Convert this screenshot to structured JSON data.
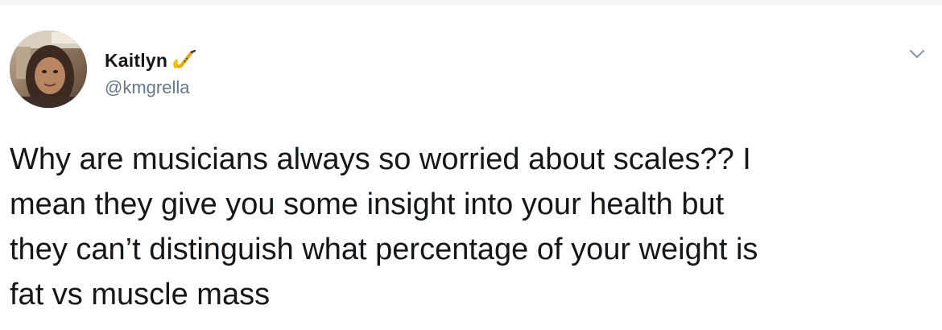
{
  "author": {
    "display_name": "Kaitlyn",
    "handle": "@kmgrella",
    "badge_icon": "saxophone-emoji-icon",
    "avatar": "profile-photo"
  },
  "tweet": {
    "text": "Why are musicians always so worried about scales?? I\nmean they give you some insight into your health but\nthey can’t distinguish what percentage of your weight is\nfat vs muscle mass"
  },
  "menu": {
    "icon": "chevron-down-icon"
  },
  "colors": {
    "text": "#14171a",
    "secondary": "#657786",
    "badge": "#f5b800"
  }
}
